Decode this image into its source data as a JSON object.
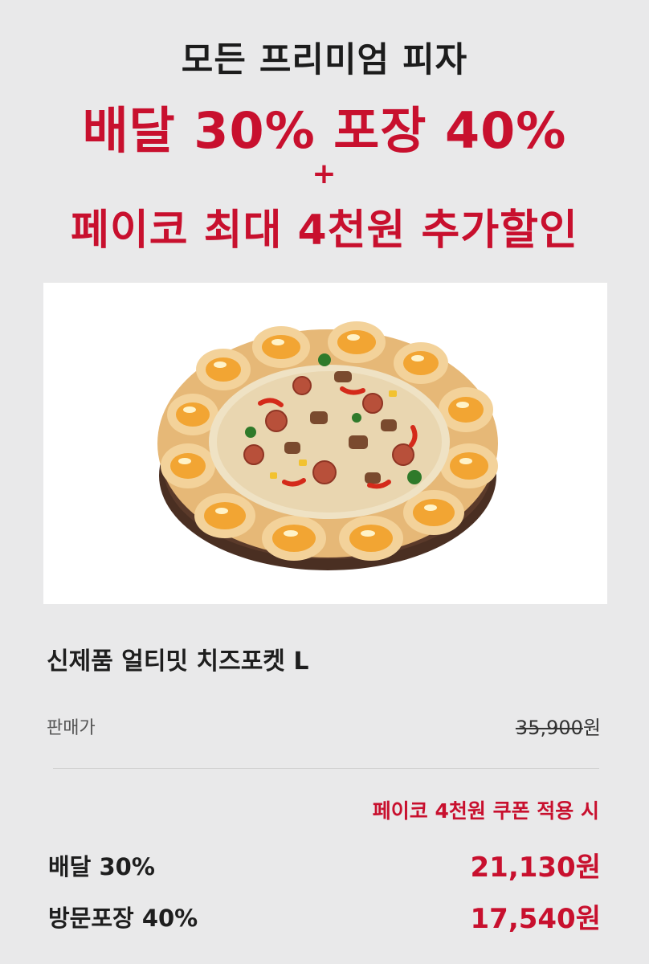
{
  "promo": {
    "title": "모든 프리미엄 피자",
    "discount_line": "배달 30% 포장 40%",
    "plus": "+",
    "extra_line": "페이코 최대 4천원 추가할인"
  },
  "product": {
    "image": "pizza-image",
    "name": "신제품 얼티밋 치즈포켓 L"
  },
  "price": {
    "label": "판매가",
    "original": "35,900",
    "unit": "원"
  },
  "coupon_note": "페이코 4천원 쿠폰 적용 시",
  "discounts": [
    {
      "label": "배달 30%",
      "price": "21,130원"
    },
    {
      "label": "방문포장 40%",
      "price": "17,540원"
    }
  ],
  "colors": {
    "background": "#e9e9ea",
    "accent": "#c8102e",
    "text": "#1e1e1e"
  }
}
